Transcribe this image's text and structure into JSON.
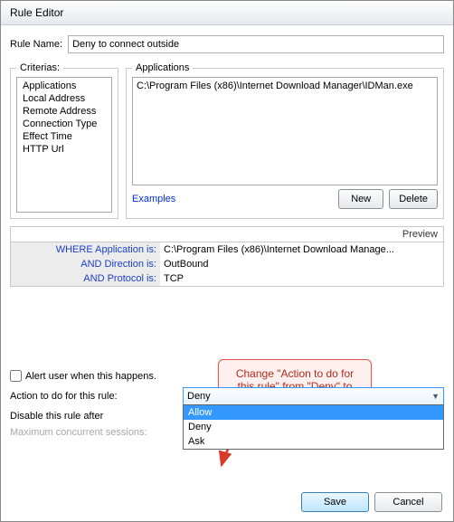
{
  "title": "Rule Editor",
  "ruleName": {
    "label": "Rule Name:",
    "value": "Deny to connect outside"
  },
  "criterias": {
    "legend": "Criterias:",
    "items": [
      "Applications",
      "Local Address",
      "Remote Address",
      "Connection Type",
      "Effect Time",
      "HTTP Url"
    ]
  },
  "applications": {
    "legend": "Applications",
    "text": "C:\\Program Files (x86)\\Internet Download Manager\\IDMan.exe",
    "examples": "Examples",
    "new": "New",
    "delete": "Delete"
  },
  "preview": {
    "heading": "Preview",
    "rows": [
      {
        "key": "WHERE Application is:",
        "value": "C:\\Program Files (x86)\\Internet Download Manage..."
      },
      {
        "key": "AND Direction is:",
        "value": "OutBound"
      },
      {
        "key": "AND Protocol is:",
        "value": "TCP"
      }
    ]
  },
  "alert": {
    "label": "Alert user when this happens."
  },
  "action": {
    "label": "Action to do for this rule:",
    "selected": "Deny",
    "options": [
      "Allow",
      "Deny",
      "Ask"
    ]
  },
  "disableAfter": {
    "label": "Disable this rule after"
  },
  "maxSessions": {
    "label": "Maximum concurrent sessions:"
  },
  "buttons": {
    "save": "Save",
    "cancel": "Cancel"
  },
  "callout": "Change \"Action to do for this rule\" from \"Deny\" to \"Allow\""
}
